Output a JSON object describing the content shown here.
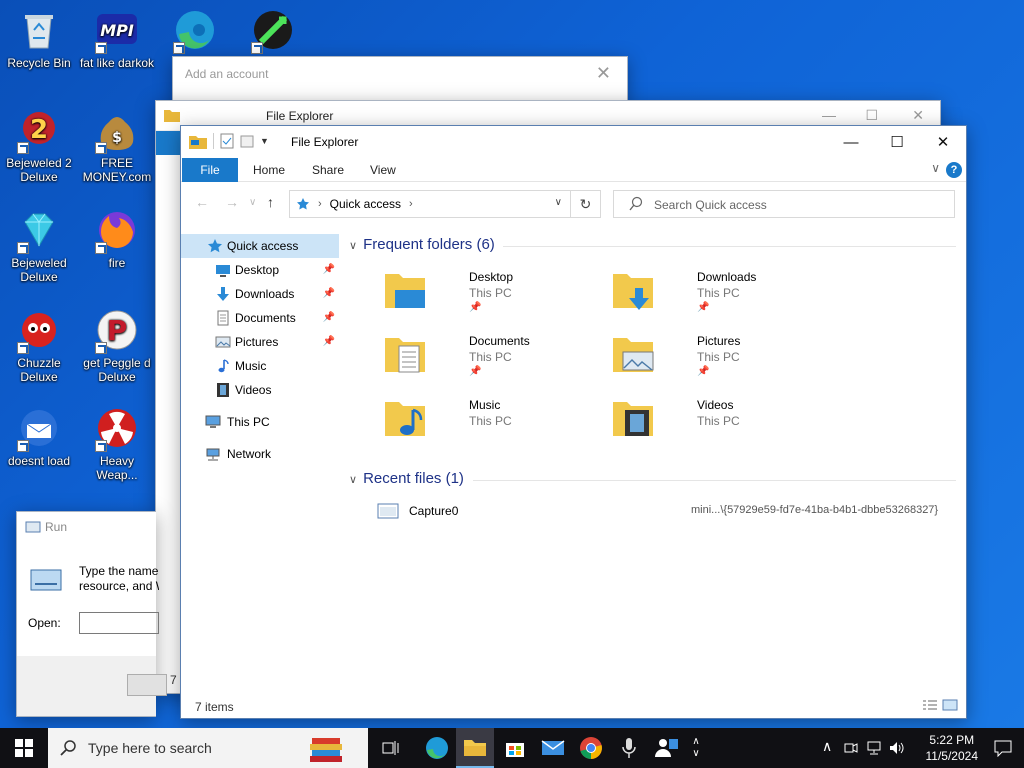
{
  "desktop": {
    "icons": [
      {
        "label": "Recycle Bin"
      },
      {
        "label": "fat like darkok"
      },
      {
        "label": "Bejeweled 2 Deluxe"
      },
      {
        "label": "FREE MONEY.com"
      },
      {
        "label": "Bejeweled Deluxe"
      },
      {
        "label": "fire"
      },
      {
        "label": "Chuzzle Deluxe"
      },
      {
        "label": "get Peggle d Deluxe"
      },
      {
        "label": "doesnt load"
      },
      {
        "label": "Heavy Weap..."
      }
    ]
  },
  "add_account": {
    "title": "Add an account",
    "close": "✕"
  },
  "explorer_back": {
    "title": "File Explorer",
    "status": "7 i"
  },
  "explorer": {
    "title": "File Explorer",
    "ribbon": {
      "file": "File",
      "home": "Home",
      "share": "Share",
      "view": "View"
    },
    "address": {
      "crumb": "Quick access"
    },
    "search_placeholder": "Search Quick access",
    "nav": [
      {
        "label": "Quick access"
      },
      {
        "label": "Desktop"
      },
      {
        "label": "Downloads"
      },
      {
        "label": "Documents"
      },
      {
        "label": "Pictures"
      },
      {
        "label": "Music"
      },
      {
        "label": "Videos"
      },
      {
        "label": "This PC"
      },
      {
        "label": "Network"
      }
    ],
    "frequent_header": "Frequent folders (6)",
    "folders": [
      {
        "name": "Desktop",
        "location": "This PC"
      },
      {
        "name": "Downloads",
        "location": "This PC"
      },
      {
        "name": "Documents",
        "location": "This PC"
      },
      {
        "name": "Pictures",
        "location": "This PC"
      },
      {
        "name": "Music",
        "location": "This PC"
      },
      {
        "name": "Videos",
        "location": "This PC"
      }
    ],
    "recent_header": "Recent files (1)",
    "recent": [
      {
        "name": "Capture0",
        "path": "mini...\\{57929e59-fd7e-41ba-b4b1-dbbe53268327}"
      }
    ],
    "status": "7 items"
  },
  "run": {
    "title": "Run",
    "desc_line1": "Type the name",
    "desc_line2": "resource, and W",
    "open_label": "Open:"
  },
  "taskbar": {
    "search_placeholder": "Type here to search",
    "time": "5:22 PM",
    "date": "11/5/2024"
  }
}
